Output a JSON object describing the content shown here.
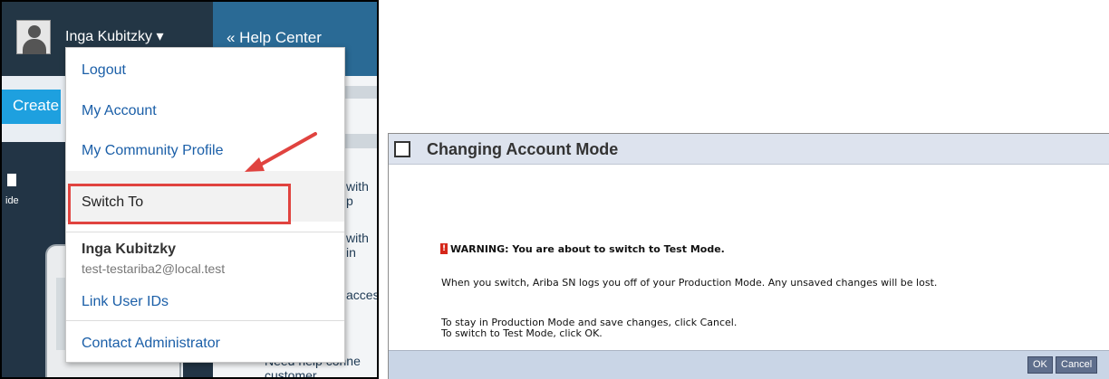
{
  "left_panel": {
    "header": {
      "user_name": "Inga Kubitzky ▾",
      "help_center": "« Help Center"
    },
    "create_label": "Create",
    "side_label": "ide",
    "content_snippets": [
      "with p",
      "with in",
      "acces",
      "Need help conne",
      "customer"
    ],
    "menu": {
      "items": [
        {
          "label": "Logout"
        },
        {
          "label": "My Account"
        },
        {
          "label": "My Community Profile"
        },
        {
          "label": "Switch To"
        },
        {
          "label": "Link User IDs"
        },
        {
          "label": "Contact Administrator"
        }
      ],
      "profile_name": "Inga Kubitzky",
      "profile_email": "test-testariba2@local.test"
    },
    "highlight_color": "#e0433f"
  },
  "dialog": {
    "title": "Changing Account Mode",
    "warning": "WARNING: You are about to switch to Test Mode.",
    "line1": "When you switch, Ariba SN logs you off of your Production Mode. Any unsaved changes will be lost.",
    "line2": "To stay in Production Mode and save changes, click Cancel.",
    "line3": "To switch to Test Mode, click OK.",
    "ok_label": "OK",
    "cancel_label": "Cancel"
  }
}
